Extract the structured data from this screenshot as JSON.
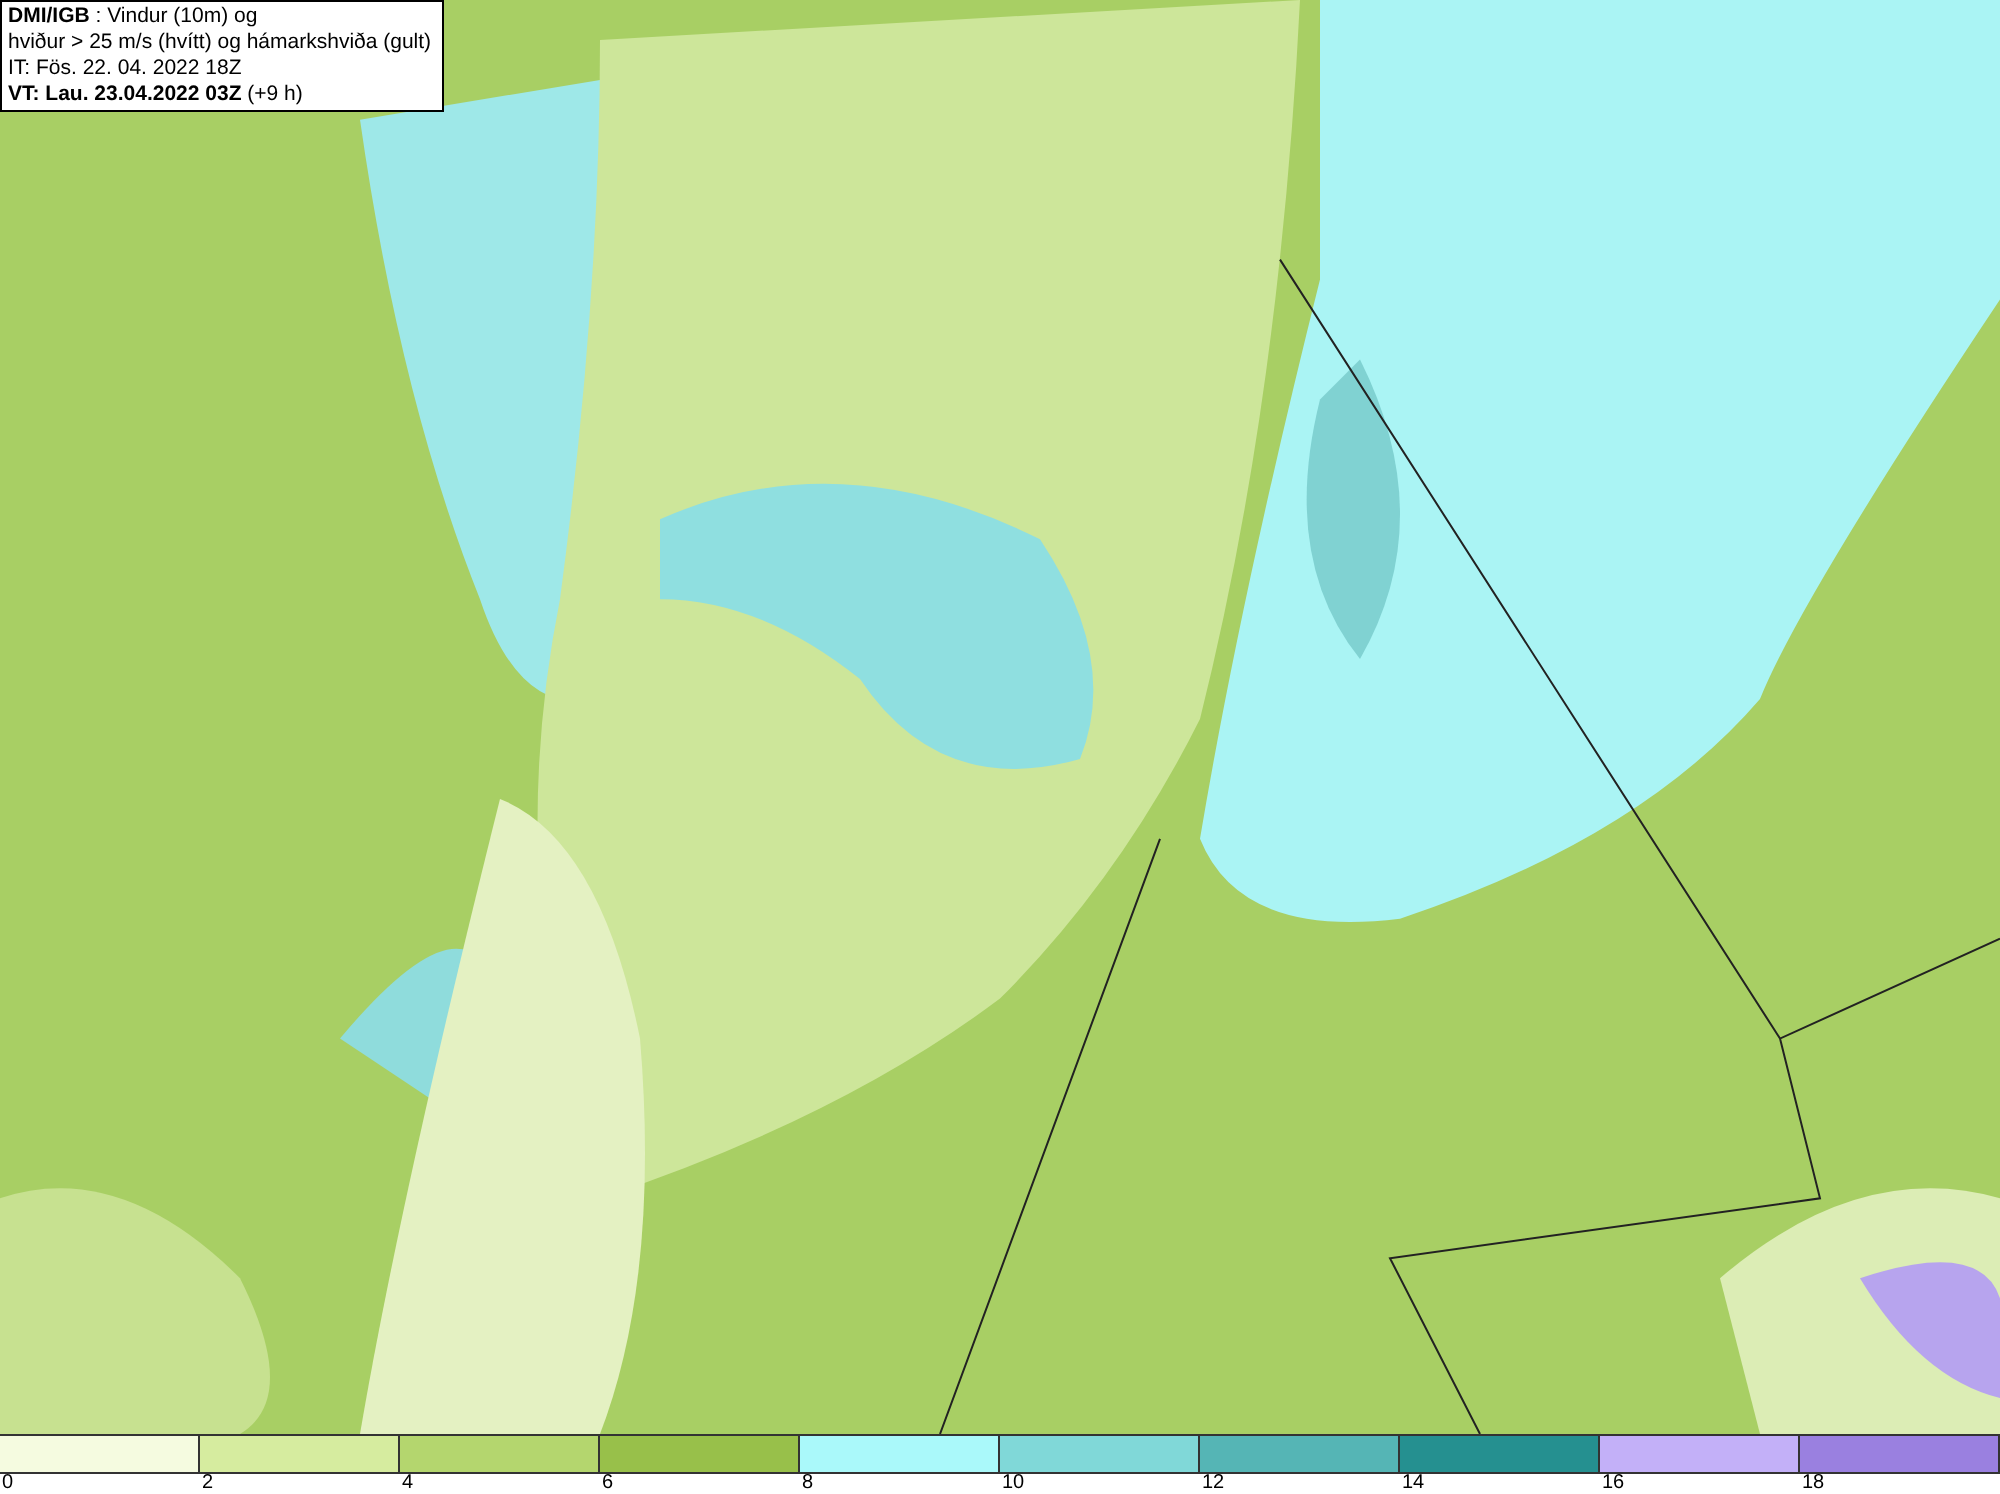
{
  "legend": {
    "lines": [
      "**DMI/IGB** : Vindur (10m) og",
      "hviður > 25 m/s (hvítt) og hámarkshviða (gult)",
      "IT: Fös. 22. 04. 2022 18Z",
      "**VT: Lau. 23.04.2022 03Z** (+9 h)"
    ]
  },
  "colorbar": {
    "segments": [
      {
        "color": "#f5fbe0"
      },
      {
        "color": "#d6ec9f"
      },
      {
        "color": "#b4d66e"
      },
      {
        "color": "#98c04a"
      },
      {
        "color": "#aaf9fa"
      },
      {
        "color": "#80d8d8"
      },
      {
        "color": "#55b5b5"
      },
      {
        "color": "#259090"
      },
      {
        "color": "#c3b0f8"
      },
      {
        "color": "#9a80e0"
      }
    ],
    "ticks": [
      "0",
      "2",
      "4",
      "6",
      "8",
      "10",
      "12",
      "14",
      "16",
      "18"
    ]
  }
}
